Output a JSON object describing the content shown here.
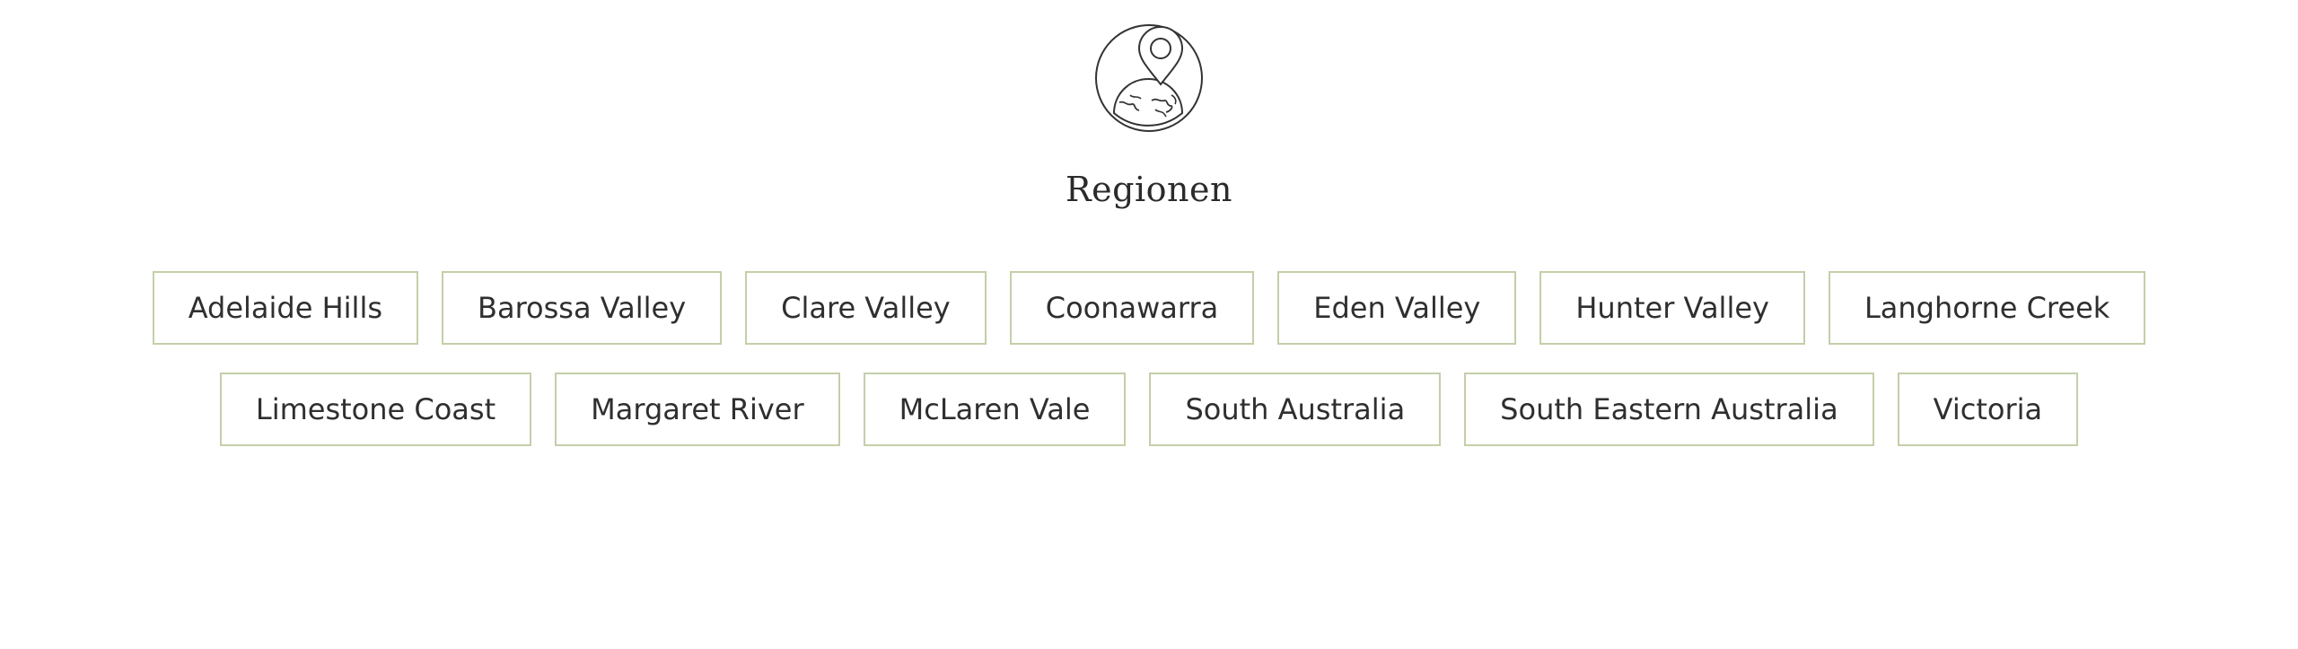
{
  "section": {
    "icon": "map-pin-globe-icon",
    "title": "Regionen"
  },
  "regions": {
    "row1": [
      "Adelaide Hills",
      "Barossa Valley",
      "Clare Valley",
      "Coonawarra",
      "Eden Valley",
      "Hunter Valley",
      "Langhorne Creek"
    ],
    "row2": [
      "Limestone Coast",
      "Margaret River",
      "McLaren Vale",
      "South Australia",
      "South Eastern Australia",
      "Victoria"
    ]
  },
  "colors": {
    "tag_border": "#c3cfa9",
    "text": "#2f2f2f",
    "background": "#ffffff"
  }
}
